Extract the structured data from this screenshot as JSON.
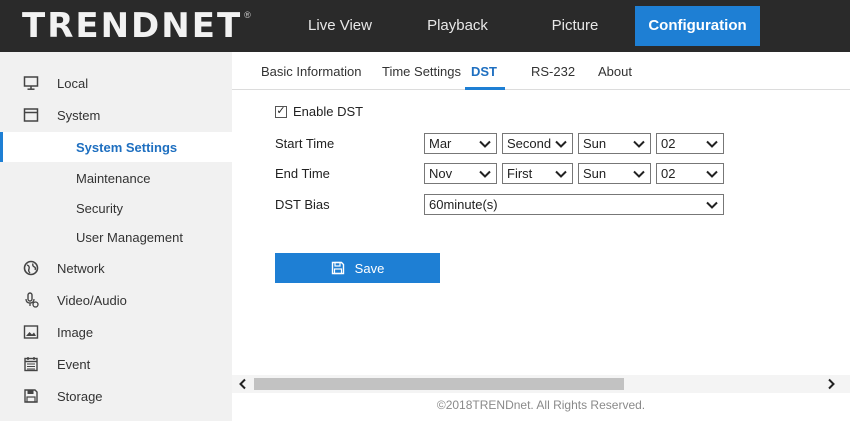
{
  "brand": {
    "logo": "TRENDNET",
    "registered": "®"
  },
  "nav": {
    "items": [
      {
        "label": "Live View"
      },
      {
        "label": "Playback"
      },
      {
        "label": "Picture"
      },
      {
        "label": "Configuration"
      }
    ],
    "active": "Configuration"
  },
  "sidebar": {
    "items": [
      {
        "label": "Local",
        "icon": "monitor-icon"
      },
      {
        "label": "System",
        "icon": "window-icon"
      },
      {
        "label": "System Settings",
        "active": true
      },
      {
        "label": "Maintenance"
      },
      {
        "label": "Security"
      },
      {
        "label": "User Management"
      },
      {
        "label": "Network",
        "icon": "globe-icon"
      },
      {
        "label": "Video/Audio",
        "icon": "microphone-icon"
      },
      {
        "label": "Image",
        "icon": "image-icon"
      },
      {
        "label": "Event",
        "icon": "calendar-icon"
      },
      {
        "label": "Storage",
        "icon": "floppy-disk-icon"
      }
    ]
  },
  "tabs": {
    "items": [
      {
        "label": "Basic Information"
      },
      {
        "label": "Time Settings"
      },
      {
        "label": "DST"
      },
      {
        "label": "RS-232"
      },
      {
        "label": "About"
      }
    ],
    "active": "DST"
  },
  "form": {
    "enable_dst": {
      "label": "Enable DST",
      "checked": true,
      "mark": "✓"
    },
    "start_time": {
      "label": "Start Time",
      "month": "Mar",
      "week": "Second",
      "day": "Sun",
      "hour": "02"
    },
    "end_time": {
      "label": "End Time",
      "month": "Nov",
      "week": "First",
      "day": "Sun",
      "hour": "02"
    },
    "dst_bias": {
      "label": "DST Bias",
      "value": "60minute(s)"
    },
    "save_label": "Save"
  },
  "scrollbar": {
    "left_arrow": "<",
    "right_arrow": ">"
  },
  "footer": {
    "copyright": "©2018TRENDnet. All Rights Reserved."
  },
  "colors": {
    "accent": "#1e7fd4",
    "topbar": "#2a2a2a",
    "sidebar": "#f1f1f1"
  }
}
